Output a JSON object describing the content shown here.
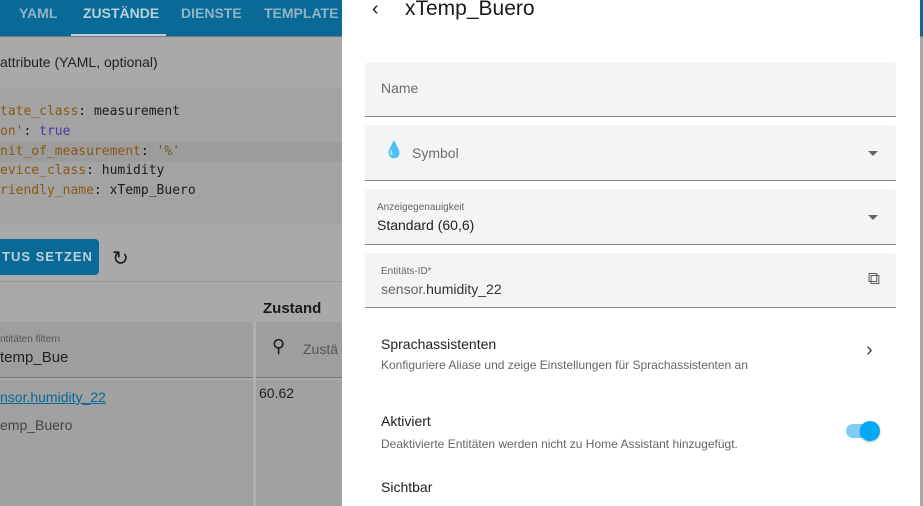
{
  "tabs": [
    {
      "label": "YAML"
    },
    {
      "label": "ZUSTÄNDE"
    },
    {
      "label": "DIENSTE"
    },
    {
      "label": "TEMPLATE"
    }
  ],
  "attributes_label": "attribute (YAML, optional)",
  "yaml": [
    {
      "key": "tate_class",
      "value": "measurement"
    },
    {
      "key": "on'",
      "value": "true"
    },
    {
      "key": "nit_of_measurement",
      "value": "'%'"
    },
    {
      "key": "evice_class",
      "value": "humidity"
    },
    {
      "key": "riendly_name",
      "value": "xTemp_Buero"
    }
  ],
  "set_state_button": "TUS SETZEN",
  "refresh_icon": "↻",
  "table": {
    "state_header": "Zustand",
    "filter_label": "ntitäten filtern",
    "filter_value": "temp_Bue",
    "state_filter_placeholder": "Zustä",
    "row": {
      "entity_id": "nsor.humidity_22",
      "name": "emp_Buero",
      "state": "60.62"
    }
  },
  "dialog": {
    "title": "xTemp_Buero",
    "name_label": "Name",
    "symbol_label": "Symbol",
    "precision_label": "Anzeigegenauigkeit",
    "precision_value": "Standard (60,6)",
    "entity_id_label": "Entitäts-ID*",
    "entity_id_prefix": "sensor.",
    "entity_id_value": "humidity_22",
    "voice_title": "Sprachassistenten",
    "voice_sub": "Konfiguriere Aliase und zeige Einstellungen für Sprachassistenten an",
    "enabled_title": "Aktiviert",
    "enabled_sub": "Deaktivierte Entitäten werden nicht zu Home Assistant hinzugefügt.",
    "enabled_on": true,
    "visible_title": "Sichtbar"
  },
  "colors": {
    "accent": "#03a9f4",
    "header": "#0a6a97"
  }
}
